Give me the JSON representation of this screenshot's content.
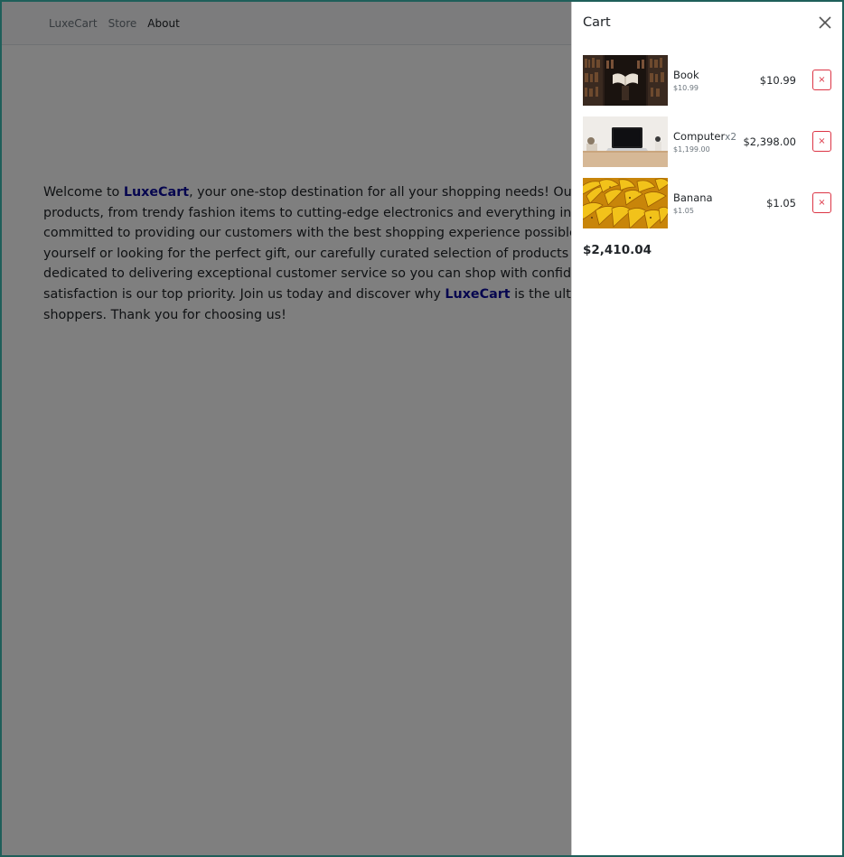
{
  "navbar": {
    "links": [
      {
        "label": "LuxeCart"
      },
      {
        "label": "Store"
      },
      {
        "label": "About"
      }
    ]
  },
  "about": {
    "part1": "Welcome to ",
    "brand": "LuxeCart",
    "part2": ", your one-stop destination for all your shopping needs! Our store offers a wide range of products, from trendy fashion items to cutting-edge electronics and everything in between. At ",
    "part3": ", we are committed to providing our customers with the best shopping experience possible. Whether you're shopping for yourself or looking for the perfect gift, our carefully curated selection of products is sure to delight. Our team is dedicated to delivering exceptional customer service so you can shop with confidence knowing that your satisfaction is our top priority. Join us today and discover why ",
    "part4": " is the ultimate destination for savvy shoppers. Thank you for choosing us!"
  },
  "cart": {
    "title": "Cart",
    "items": [
      {
        "name": "Book",
        "qty": "",
        "unit_price": "$10.99",
        "total": "$10.99",
        "remove_label": "×",
        "image": "book-photo"
      },
      {
        "name": "Computer",
        "qty": "x2",
        "unit_price": "$1,199.00",
        "total": "$2,398.00",
        "remove_label": "×",
        "image": "laptop-photo"
      },
      {
        "name": "Banana",
        "qty": "",
        "unit_price": "$1.05",
        "total": "$1.05",
        "remove_label": "×",
        "image": "banana-photo"
      }
    ],
    "total": "$2,410.04"
  },
  "colors": {
    "brand": "#0d0d9f",
    "danger": "#dc3545",
    "backdrop": "rgba(0,0,0,0.5)"
  }
}
